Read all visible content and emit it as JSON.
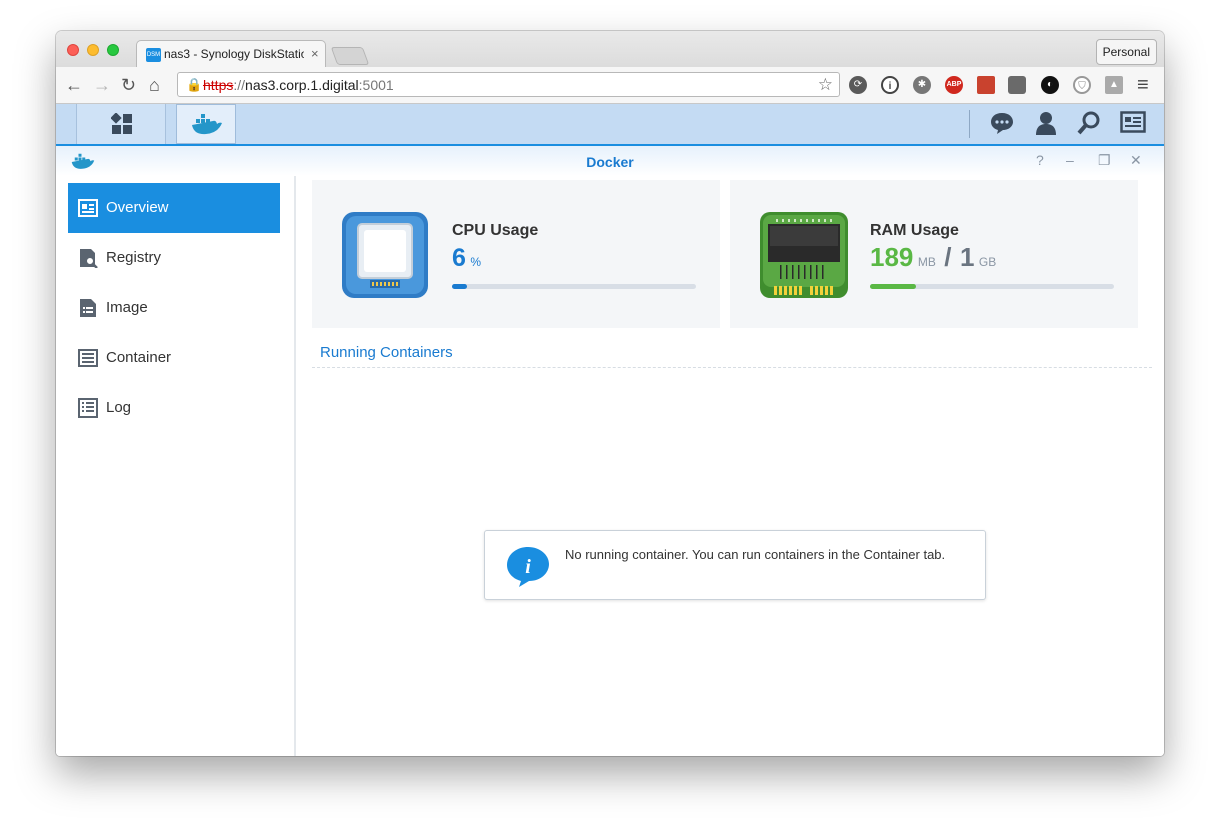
{
  "browser": {
    "tab_title": "nas3 - Synology DiskStatio",
    "tab_favicon": "DSM",
    "tab_close": "×",
    "profile_label": "Personal",
    "url_protocol": "https",
    "url_sep": "://",
    "url_host": "nas3.corp.1.digital",
    "url_port": ":5001",
    "back": "←",
    "forward": "→",
    "reload": "↻",
    "home": "⌂",
    "star": "☆",
    "menu": "≡",
    "abp_label": "ABP",
    "extensions": [
      "sync-icon",
      "info-icon",
      "film-icon",
      "adblock-plus-icon",
      "book-icon",
      "puzzle-icon",
      "chrome-icon",
      "shield-icon",
      "drive-icon"
    ]
  },
  "taskbar": {
    "icons": [
      "main-menu-icon",
      "docker-icon",
      "chat-icon",
      "user-icon",
      "search-icon",
      "widgets-icon"
    ]
  },
  "app": {
    "title": "Docker",
    "help": "?",
    "minimize": "–",
    "restore": "❐",
    "close": "✕"
  },
  "sidebar": {
    "items": [
      {
        "label": "Overview",
        "icon": "overview-icon",
        "active": true
      },
      {
        "label": "Registry",
        "icon": "registry-icon",
        "active": false
      },
      {
        "label": "Image",
        "icon": "image-icon",
        "active": false
      },
      {
        "label": "Container",
        "icon": "container-icon",
        "active": false
      },
      {
        "label": "Log",
        "icon": "log-icon",
        "active": false
      }
    ]
  },
  "cpu": {
    "label": "CPU Usage",
    "value": "6",
    "unit": "%",
    "percent": 6,
    "color": "#1a7bd0"
  },
  "ram": {
    "label": "RAM Usage",
    "used": "189",
    "used_unit": "MB",
    "separator": "/",
    "total": "1",
    "total_unit": "GB",
    "percent": 19,
    "color": "#5ab845"
  },
  "running": {
    "heading": "Running Containers",
    "empty_message": "No running container. You can run containers in the Container tab."
  }
}
